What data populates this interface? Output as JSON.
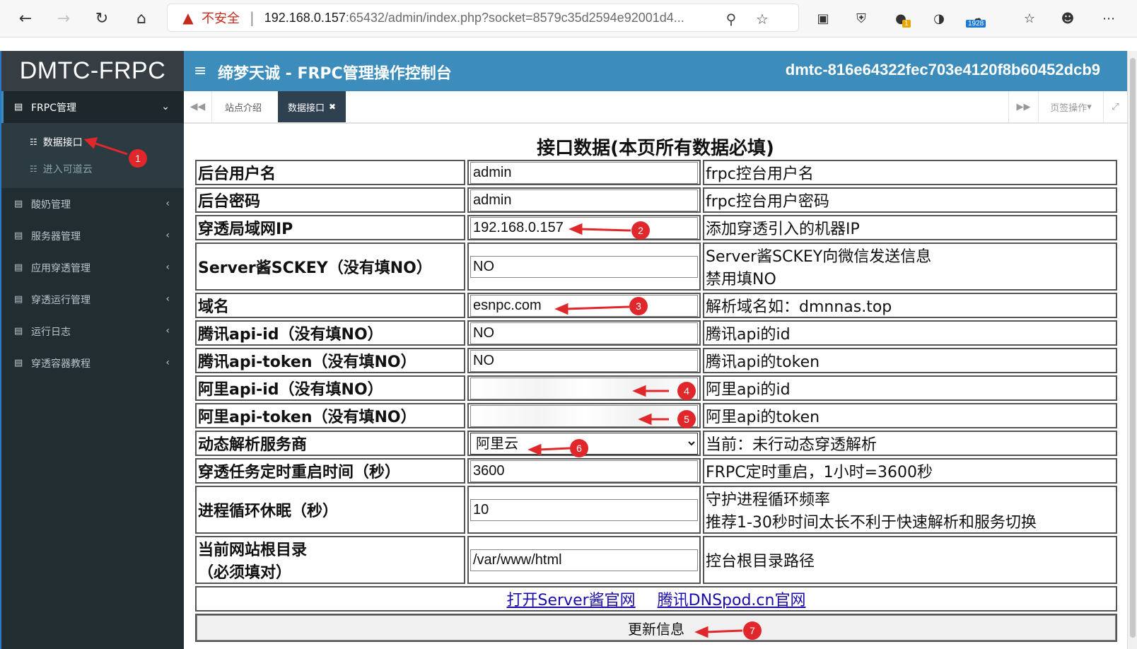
{
  "browser": {
    "insecure_label": "不安全",
    "url_host": "192.168.0.157",
    "url_rest": ":65432/admin/index.php?socket=8579c35d2594e92001d4...",
    "ext_badge_1": "1",
    "ext_badge_2": "1928",
    "colors": {
      "warning": "#c42b1c"
    }
  },
  "header": {
    "brand": "DMTC-FRPC",
    "menu_icon": "≡",
    "title": "缔梦天诚 - FRPC管理操作控制台",
    "user_id": "dmtc-816e64322fec703e4120f8b60452dcb9",
    "colors": {
      "topbar": "#3c8dbc",
      "brand_bg": "#363e44",
      "sidebar": "#222d32"
    }
  },
  "sidebar": {
    "group_active": "FRPC管理",
    "sub_items": [
      "数据接口",
      "进入可道云"
    ],
    "groups": [
      "酸奶管理",
      "服务器管理",
      "应用穿透管理",
      "穿透运行管理",
      "运行日志",
      "穿透容器教程"
    ]
  },
  "tabs": {
    "items": [
      "站点介绍",
      "数据接口"
    ],
    "page_ops": "页签操作"
  },
  "form": {
    "heading": "接口数据(本页所有数据必填)",
    "rows": [
      {
        "label": "后台用户名",
        "value": "admin",
        "desc": "frpc控台用户名"
      },
      {
        "label": "后台密码",
        "value": "admin",
        "desc": "frpc控台用户密码"
      },
      {
        "label": "穿透局域网IP",
        "value": "192.168.0.157",
        "desc": "添加穿透引入的机器IP"
      },
      {
        "label": "Server酱SCKEY（没有填NO）",
        "value": "NO",
        "desc_line1": "Server酱SCKEY向微信发送信息",
        "desc_line2": "禁用填NO"
      },
      {
        "label": "域名",
        "value": "esnpc.com",
        "desc": "解析域名如：dmnnas.top"
      },
      {
        "label": "腾讯api-id（没有填NO）",
        "value": "NO",
        "desc": "腾讯api的id"
      },
      {
        "label": "腾讯api-token（没有填NO）",
        "value": "NO",
        "desc": "腾讯api的token"
      },
      {
        "label": "阿里api-id（没有填NO）",
        "value": "",
        "desc": "阿里api的id"
      },
      {
        "label": "阿里api-token（没有填NO）",
        "value": "",
        "desc": "阿里api的token"
      },
      {
        "label": "动态解析服务商",
        "selected": "阿里云",
        "desc": "当前：未行动态穿透解析"
      },
      {
        "label": "穿透任务定时重启时间（秒）",
        "value": "3600",
        "desc": "FRPC定时重启，1小时=3600秒"
      },
      {
        "label": "进程循环休眠（秒）",
        "value": "10",
        "desc_line1": "守护进程循环频率",
        "desc_line2": "推荐1-30秒时间太长不利于快速解析和服务切换"
      },
      {
        "label_line1": "当前网站根目录",
        "label_line2": "（必须填对）",
        "value": "/var/www/html",
        "desc": "控台根目录路径"
      }
    ],
    "links": [
      "打开Server酱官网",
      "腾讯DNSpod.cn官网"
    ],
    "submit": "更新信息"
  },
  "callouts": [
    "1",
    "2",
    "3",
    "4",
    "5",
    "6",
    "7"
  ]
}
